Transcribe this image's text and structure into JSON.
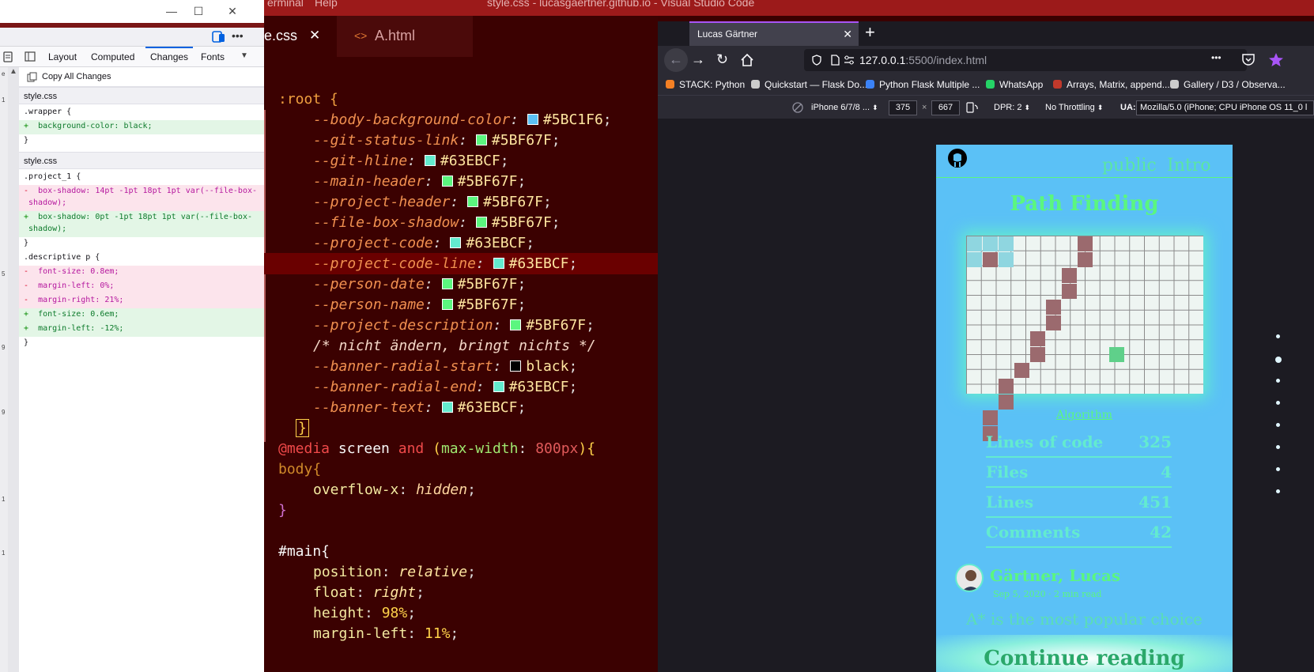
{
  "devtools": {
    "window_buttons": {
      "minimize": "—",
      "maximize": "☐",
      "close": "✕"
    },
    "tabs": [
      "Layout",
      "Computed",
      "Changes",
      "Fonts"
    ],
    "active_tab": "Changes",
    "copy_all": "Copy All Changes",
    "gutter_marks": [
      "e",
      "1",
      "5",
      "9",
      "9",
      "1",
      "1"
    ],
    "changes": [
      {
        "file": "style.css",
        "lines": [
          {
            "kind": "ctx",
            "text": ".wrapper {"
          },
          {
            "kind": "add",
            "text": "  background-color: black;"
          },
          {
            "kind": "ctx",
            "text": "}"
          }
        ]
      },
      {
        "file": "style.css",
        "lines": [
          {
            "kind": "ctx",
            "text": ".project_1 {"
          },
          {
            "kind": "del",
            "text": "  box-shadow: 14pt -1pt 18pt 1pt var(--file-box-\n shadow);"
          },
          {
            "kind": "add",
            "text": "  box-shadow: 0pt -1pt 18pt 1pt var(--file-box-\n shadow);"
          },
          {
            "kind": "ctx",
            "text": "}"
          },
          {
            "kind": "ctx",
            "text": ".descriptive p {"
          },
          {
            "kind": "del",
            "text": "  font-size: 0.8em;"
          },
          {
            "kind": "del",
            "text": "  margin-left: 0%;"
          },
          {
            "kind": "del",
            "text": "  margin-right: 21%;"
          },
          {
            "kind": "add",
            "text": "  font-size: 0.6em;"
          },
          {
            "kind": "add",
            "text": "  margin-left: -12%;"
          },
          {
            "kind": "ctx",
            "text": "}"
          }
        ]
      }
    ]
  },
  "vscode": {
    "menu_partial": [
      "erminal",
      "Help"
    ],
    "title": "style.css - lucasgaertner.github.io - Visual Studio Code",
    "tabs": [
      {
        "label": "e.css",
        "active": true,
        "close": "✕"
      },
      {
        "label": "A.html",
        "active": false,
        "icon": "<>"
      }
    ],
    "code": {
      "root_open": ":root {",
      "vars": [
        {
          "name": "--body-background-color",
          "value": "#5BC1F6",
          "color": "#5bc1f6"
        },
        {
          "name": "--git-status-link",
          "value": "#5BF67F",
          "color": "#5bf67f"
        },
        {
          "name": "--git-hline",
          "value": "#63EBCF",
          "color": "#63ebcf"
        },
        {
          "name": "--main-header",
          "value": "#5BF67F",
          "color": "#5bf67f"
        },
        {
          "name": "--project-header",
          "value": "#5BF67F",
          "color": "#5bf67f"
        },
        {
          "name": "--file-box-shadow",
          "value": "#5BF67F",
          "color": "#5bf67f"
        },
        {
          "name": "--project-code",
          "value": "#63EBCF",
          "color": "#63ebcf"
        },
        {
          "name": "--project-code-line",
          "value": "#63EBCF",
          "color": "#63ebcf"
        },
        {
          "name": "--person-date",
          "value": "#5BF67F",
          "color": "#5bf67f"
        },
        {
          "name": "--person-name",
          "value": "#5BF67F",
          "color": "#5bf67f"
        },
        {
          "name": "--project-description",
          "value": "#5BF67F",
          "color": "#5bf67f"
        }
      ],
      "comment": "/* nicht ändern, bringt nichts */",
      "vars2": [
        {
          "name": "--banner-radial-start",
          "value": "black",
          "color": "#000000"
        },
        {
          "name": "--banner-radial-end",
          "value": "#63EBCF",
          "color": "#63ebcf"
        },
        {
          "name": "--banner-text",
          "value": "#63EBCF",
          "color": "#63ebcf"
        }
      ],
      "root_close": "}",
      "media_line": {
        "at": "@media",
        "kw1": "screen",
        "kw2": "and",
        "open": "(",
        "prop": "max-width",
        "colon": ":",
        "val": "800px",
        "close": "){"
      },
      "body_sel": "body{",
      "body_prop": "overflow-x",
      "body_val": "hidden",
      "close_brace": "}",
      "main_sel": "#main{",
      "main_props": [
        {
          "p": "position",
          "v": "relative"
        },
        {
          "p": "float",
          "v": "right"
        },
        {
          "p": "height",
          "v": "98%"
        },
        {
          "p": "margin-left",
          "v": "11%"
        }
      ]
    }
  },
  "firefox": {
    "tab_title": "Lucas Gärtner",
    "tab_close": "✕",
    "new_tab": "+",
    "url_host": "127.0.0.1",
    "url_rest": ":5500/index.html",
    "menu_dots": "•••",
    "bookmarks": [
      "STACK: Python",
      "Quickstart — Flask Do...",
      "Python Flask Multiple ...",
      "WhatsApp",
      "Arrays, Matrix, append...",
      "Gallery / D3 / Observa..."
    ],
    "rdm": {
      "device": "iPhone 6/7/8 ...",
      "width": "375",
      "times": "×",
      "height": "667",
      "dpr": "DPR: 2",
      "throttle": "No Throttling",
      "ua_label": "UA:",
      "ua_value": "Mozilla/5.0 (iPhone; CPU iPhone OS 11_0 l"
    }
  },
  "phone_page": {
    "nav_links": [
      "public",
      "Intro"
    ],
    "project_title": "Path Finding",
    "algorithm_link": "Algorithm",
    "stats": [
      {
        "label": "Lines of code",
        "value": "325"
      },
      {
        "label": "Files",
        "value": "4"
      },
      {
        "label": "Lines",
        "value": "451"
      },
      {
        "label": "Comments",
        "value": "42"
      }
    ],
    "author": "Gärtner, Lucas",
    "date": "Sep 5, 2020 · 2 min read",
    "teaser": "A* is the most popular choice",
    "continue": "Continue reading",
    "grid": {
      "cols": 15,
      "rows": 10,
      "walls": [
        [
          1,
          1
        ],
        [
          0,
          7
        ],
        [
          1,
          7
        ],
        [
          2,
          6
        ],
        [
          3,
          6
        ],
        [
          4,
          5
        ],
        [
          5,
          5
        ],
        [
          6,
          4
        ],
        [
          7,
          4
        ],
        [
          8,
          3
        ],
        [
          9,
          2
        ],
        [
          10,
          2
        ],
        [
          11,
          1
        ],
        [
          12,
          1
        ]
      ],
      "walls_rc": "row,col pairs",
      "start_cells": [
        [
          0,
          0
        ],
        [
          1,
          0
        ],
        [
          0,
          1
        ],
        [
          0,
          2
        ],
        [
          1,
          2
        ]
      ],
      "goal_cell": [
        7,
        9
      ]
    }
  },
  "colors": {
    "accent_green": "#5BF67F",
    "accent_teal": "#63EBCF",
    "page_bg": "#5BC1F6",
    "wall": "#9b6a6e",
    "start": "#8fd6e0",
    "goal": "#5fd08a"
  }
}
